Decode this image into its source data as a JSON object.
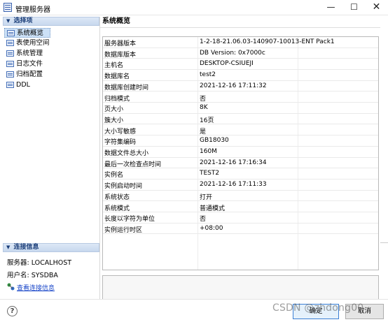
{
  "window": {
    "title": "管理服务器",
    "min_icon": "minimize-icon",
    "max_icon": "maximize-icon",
    "close_icon": "close-icon"
  },
  "sidebar": {
    "header": "选择项",
    "items": [
      {
        "label": "系统概览",
        "selected": true
      },
      {
        "label": "表使用空间",
        "selected": false
      },
      {
        "label": "系统管理",
        "selected": false
      },
      {
        "label": "日志文件",
        "selected": false
      },
      {
        "label": "归档配置",
        "selected": false
      },
      {
        "label": "DDL",
        "selected": false
      }
    ]
  },
  "connection": {
    "header": "连接信息",
    "server_line": "服务器: LOCALHOST",
    "user_line": "用户名: SYSDBA",
    "link": "查看连接信息"
  },
  "main": {
    "title": "系统概览",
    "properties": [
      {
        "name": "服务器版本",
        "value": "1-2-18-21.06.03-140907-10013-ENT  Pack1"
      },
      {
        "name": "数据库版本",
        "value": "DB Version: 0x7000c"
      },
      {
        "name": "主机名",
        "value": "DESKTOP-CSIUEJI"
      },
      {
        "name": "数据库名",
        "value": "test2"
      },
      {
        "name": "数据库创建时间",
        "value": "2021-12-16 17:11:32"
      },
      {
        "name": "归档模式",
        "value": "否"
      },
      {
        "name": "页大小",
        "value": "8K"
      },
      {
        "name": "簇大小",
        "value": "16页"
      },
      {
        "name": "大小写敏感",
        "value": "是"
      },
      {
        "name": "字符集编码",
        "value": "GB18030"
      },
      {
        "name": "数据文件总大小",
        "value": "160M"
      },
      {
        "name": "最后一次检查点时间",
        "value": "2021-12-16 17:16:34"
      },
      {
        "name": "实例名",
        "value": "TEST2"
      },
      {
        "name": "实例启动时间",
        "value": "2021-12-16 17:11:33"
      },
      {
        "name": "系统状态",
        "value": "打开"
      },
      {
        "name": "系统模式",
        "value": "普通模式"
      },
      {
        "name": "长度以字符为单位",
        "value": "否"
      },
      {
        "name": "实例运行时区",
        "value": "+08:00"
      }
    ]
  },
  "buttons": {
    "ok": "确定",
    "cancel": "取消"
  },
  "watermark": "CSDN @zhdong00",
  "colors": {
    "accent": "#1a3d78",
    "selection": "#cce1f7",
    "link": "#1a47c9"
  }
}
